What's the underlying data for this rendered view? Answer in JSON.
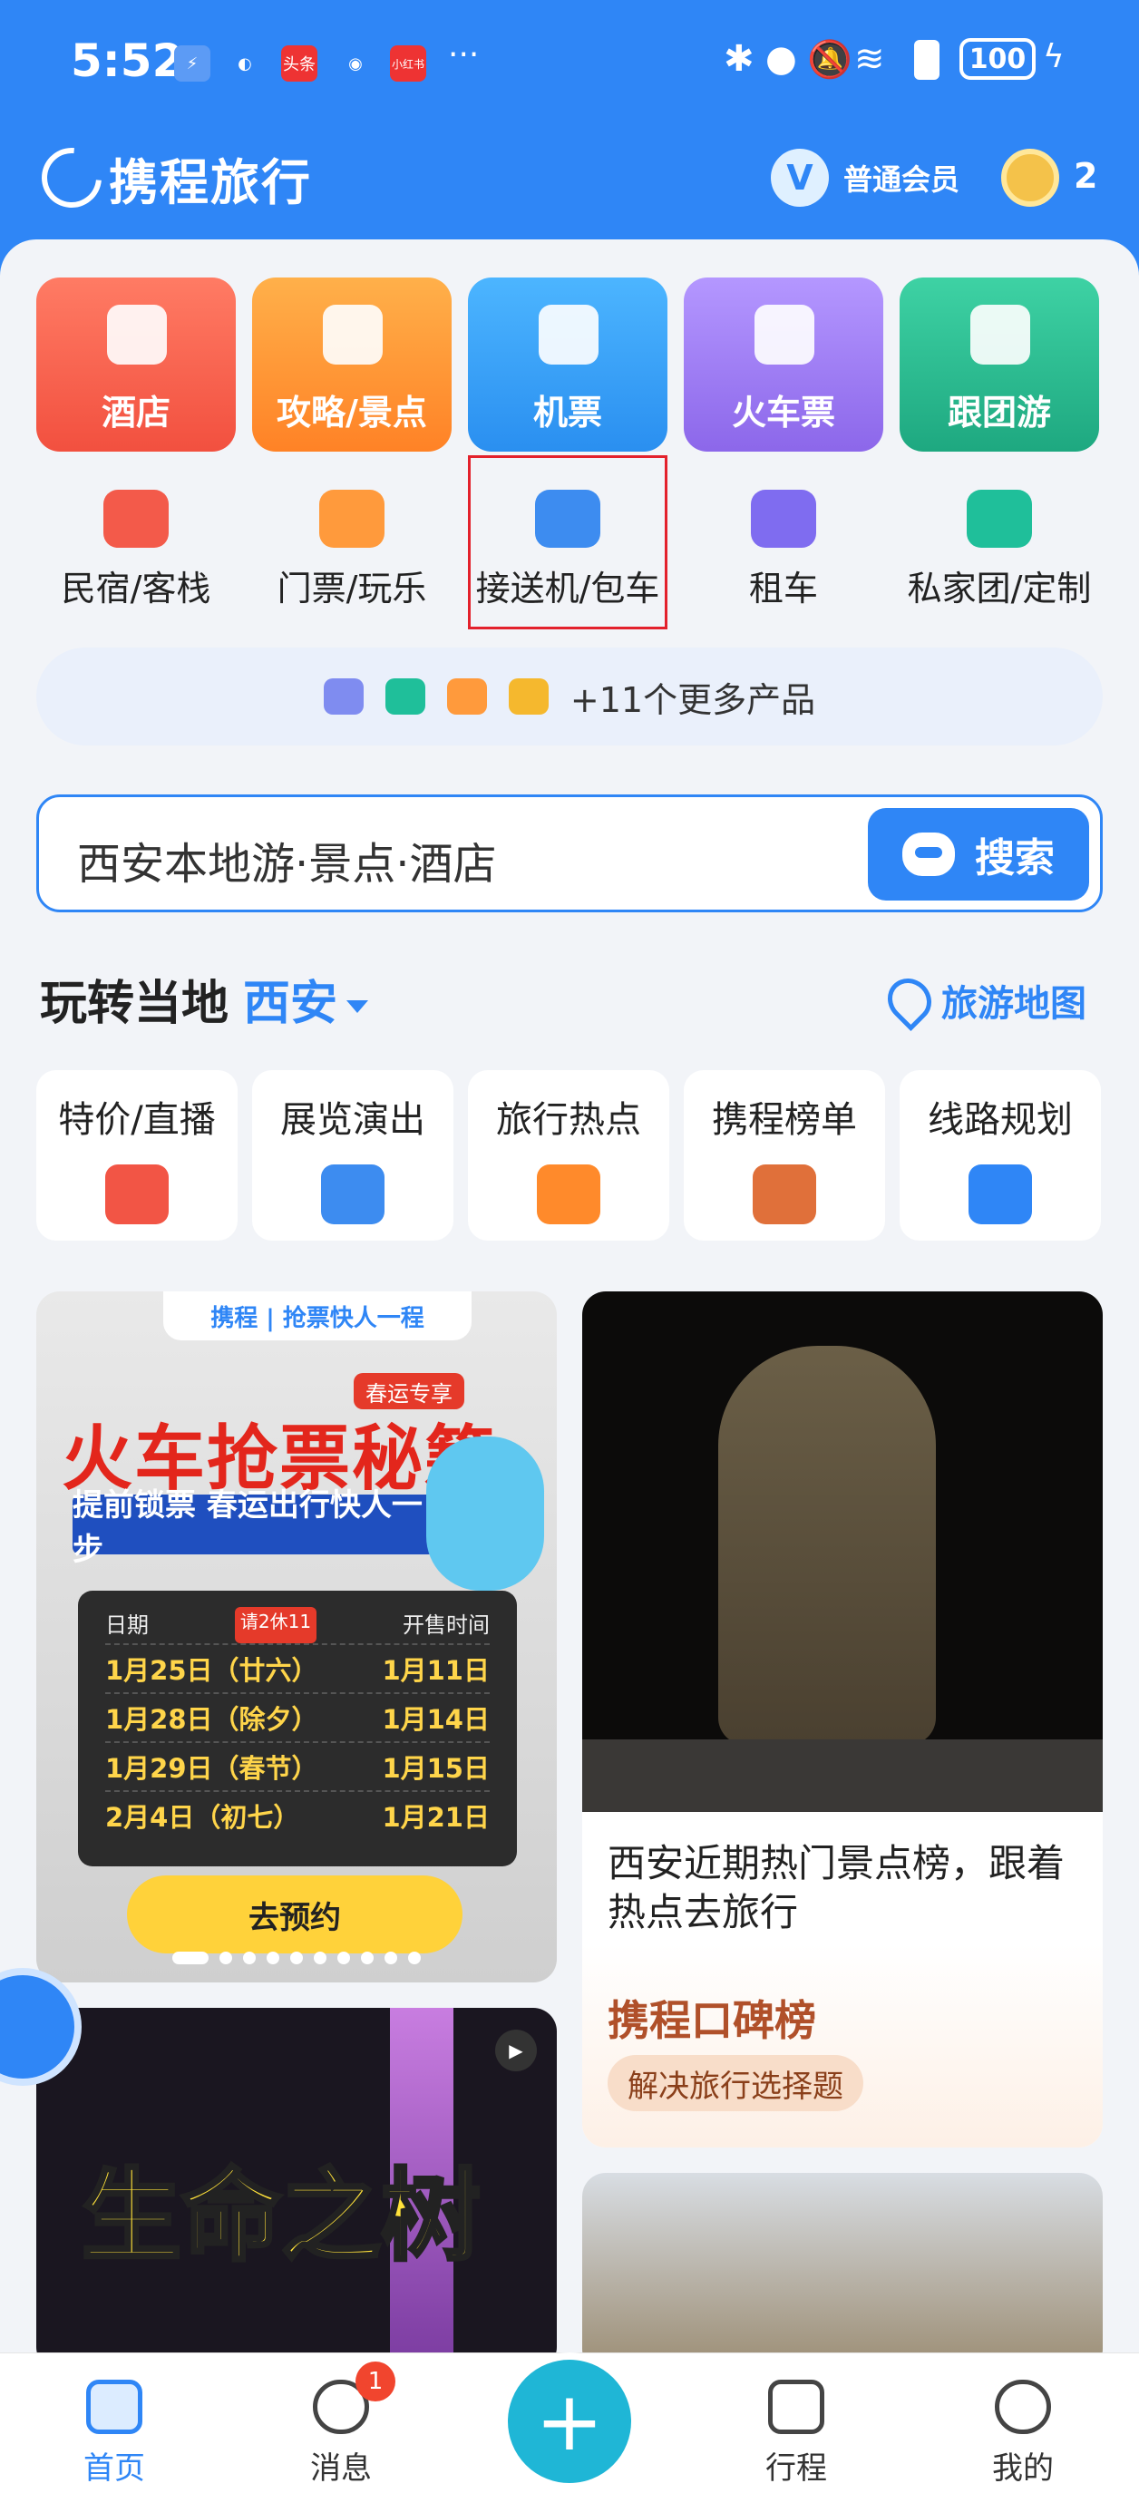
{
  "status_bar": {
    "time": "5:52",
    "notif_apps": [
      "头条",
      "小红书"
    ],
    "more": "···",
    "battery": "100"
  },
  "header": {
    "brand": "携程旅行",
    "member_badge": "V",
    "member_label": "普通会员",
    "coin_count": "2"
  },
  "categories": [
    {
      "label": "酒店",
      "icon": "hotel-icon",
      "color": "#f35a4a"
    },
    {
      "label": "攻略/景点",
      "icon": "guide-book-icon",
      "color": "#ff8a2b"
    },
    {
      "label": "机票",
      "icon": "airplane-icon",
      "color": "#2e9bf2"
    },
    {
      "label": "火车票",
      "icon": "train-icon",
      "color": "#9b73ec"
    },
    {
      "label": "跟团游",
      "icon": "palm-tree-icon",
      "color": "#26b58a"
    }
  ],
  "subcategories": [
    {
      "label": "民宿/客栈",
      "icon": "homestay-icon",
      "color": "#f35a4a"
    },
    {
      "label": "门票/玩乐",
      "icon": "ticket-icon",
      "color": "#ff9a3c"
    },
    {
      "label": "接送机/包车",
      "icon": "airport-transfer-icon",
      "color": "#3d8cf0"
    },
    {
      "label": "租车",
      "icon": "car-rental-icon",
      "color": "#7f6cf0"
    },
    {
      "label": "私家团/定制",
      "icon": "private-tour-icon",
      "color": "#1fbf9a"
    }
  ],
  "more_products": {
    "text": "+11个更多产品",
    "icons": [
      "bus-icon",
      "ship-icon",
      "visa-icon",
      "money-bag-icon"
    ]
  },
  "search": {
    "placeholder": "西安本地游·景点·酒店",
    "button": "搜索"
  },
  "local": {
    "title": "玩转当地",
    "city": "西安",
    "map_link": "旅游地图"
  },
  "tiles": [
    {
      "label": "特价/直播",
      "icon": "price-tag-icon",
      "color": "#f25545"
    },
    {
      "label": "展览演出",
      "icon": "music-note-icon",
      "color": "#3d8cf0"
    },
    {
      "label": "旅行热点",
      "icon": "hot-flag-icon",
      "color": "#ff8a2b"
    },
    {
      "label": "携程榜单",
      "icon": "ranking-icon",
      "color": "#e0703a"
    },
    {
      "label": "线路规划",
      "icon": "route-icon",
      "color": "#2f86f6"
    }
  ],
  "feed_left": {
    "top_tag": "携程 | 抢票快人一程",
    "spring_tag": "春运专享",
    "title": "火车抢票秘籍",
    "subtitle": "提前锁票 春运出行快人一步",
    "board_header": [
      "日期",
      "开售时间"
    ],
    "holiday_tag": "请2休11",
    "rows": [
      {
        "date": "1月25日（廿六）",
        "sale": "1月11日"
      },
      {
        "date": "1月28日（除夕）",
        "sale": "1月14日"
      },
      {
        "date": "1月29日（春节）",
        "sale": "1月15日"
      },
      {
        "date": "2月4日（初七）",
        "sale": "1月21日"
      }
    ],
    "cta": "去预约"
  },
  "feed_right": {
    "caption": "西安近期热门景点榜，跟着热点去旅行",
    "brand": "携程口碑榜",
    "pill": "解决旅行选择题"
  },
  "feed_left2": {
    "title": "生命之树"
  },
  "tabbar": {
    "items": [
      "首页",
      "消息",
      "行程",
      "我的"
    ],
    "message_badge": "1",
    "fab": "+"
  }
}
